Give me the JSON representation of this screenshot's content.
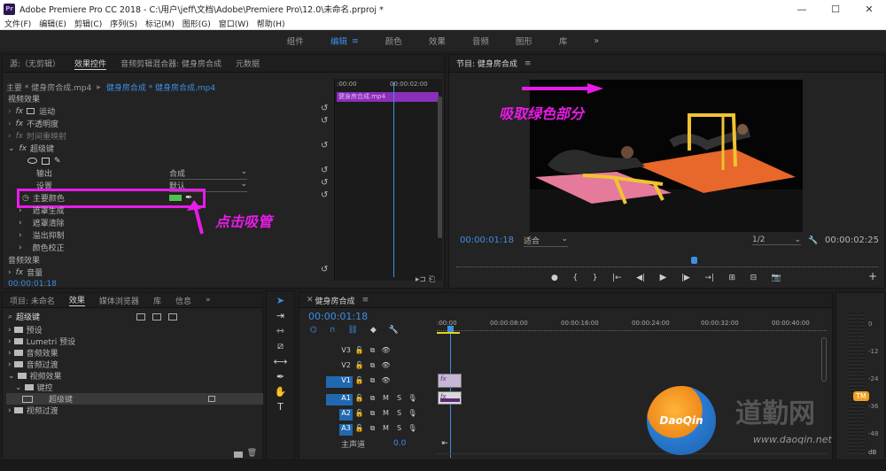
{
  "app": {
    "title": "Adobe Premiere Pro CC 2018 - C:\\用户\\jeff\\文档\\Adobe\\Premiere Pro\\12.0\\未命名.prproj *",
    "logo": "Pr"
  },
  "window": {
    "minimize": "—",
    "maximize": "☐",
    "close": "✕"
  },
  "menu": [
    "文件(F)",
    "编辑(E)",
    "剪辑(C)",
    "序列(S)",
    "标记(M)",
    "图形(G)",
    "窗口(W)",
    "帮助(H)"
  ],
  "workspaces": [
    "组件",
    "编辑",
    "颜色",
    "效果",
    "音频",
    "图形",
    "库"
  ],
  "workspace_more": "»",
  "source_panel": {
    "tabs": [
      "源:（无剪辑）",
      "效果控件",
      "音频剪辑混合器: 健身房合成",
      "元数据"
    ],
    "tab_menu": "≡",
    "clip_left": "主要 * 健身房合成.mp4",
    "clip_right": "健身房合成 * 健身房合成.mp4",
    "time_start": ":00:00",
    "time_end": "00:00:02:00",
    "clip_bar": "健身房合成.mp4",
    "video_effects": "视频效果",
    "effects": [
      "运动",
      "不透明度",
      "时间重映射",
      "超级键"
    ],
    "fx": "fx",
    "output_label": "输出",
    "output_value": "合成",
    "settings_label": "设置",
    "settings_value": "默认",
    "key_color_label": "主要颜色",
    "key_color": "#4fc24f",
    "sub_items": [
      "遮罩生成",
      "遮罩清除",
      "溢出抑制",
      "颜色校正"
    ],
    "audio_effects": "音频效果",
    "volume": "音量",
    "timecode": "00:00:01:18",
    "annotation_click": "点击吸管"
  },
  "program_panel": {
    "title": "节目: 健身房合成",
    "tab_menu": "≡",
    "annotation_pick": "吸取绿色部分",
    "timecode": "00:00:01:18",
    "fit": "适合",
    "quality": "1/2",
    "duration": "00:00:02:25",
    "controls": [
      "●",
      "{",
      "}",
      "|←",
      "◀|",
      "▶",
      "|▶",
      "→|",
      "⊞",
      "⊟",
      "📷"
    ],
    "add": "+"
  },
  "project_panel": {
    "tabs": [
      "项目: 未命名",
      "效果",
      "媒体浏览器",
      "库",
      "信息"
    ],
    "more": "»",
    "search_value": "超级键",
    "tree": [
      {
        "label": "预设",
        "level": 0,
        "type": "folder"
      },
      {
        "label": "Lumetri 预设",
        "level": 0,
        "type": "folder"
      },
      {
        "label": "音频效果",
        "level": 0,
        "type": "folder"
      },
      {
        "label": "音频过渡",
        "level": 0,
        "type": "folder"
      },
      {
        "label": "视频效果",
        "level": 0,
        "type": "folder",
        "open": true
      },
      {
        "label": "键控",
        "level": 1,
        "type": "folder",
        "open": true
      },
      {
        "label": "超级键",
        "level": 2,
        "type": "effect",
        "selected": true
      },
      {
        "label": "视频过渡",
        "level": 0,
        "type": "folder"
      }
    ]
  },
  "timeline": {
    "title": "健身房合成",
    "tab_menu": "≡",
    "timecode": "00:00:01:18",
    "ruler": [
      ":00:00",
      "00:00:08:00",
      "00:00:16:00",
      "00:00:24:00",
      "00:00:32:00",
      "00:00:40:00"
    ],
    "video_tracks": [
      "V3",
      "V2",
      "V1"
    ],
    "audio_tracks": [
      "A1",
      "A2",
      "A3"
    ],
    "master": "主声道",
    "master_value": "0.0",
    "clip_v_label": "fx",
    "clip_a_label": "fx"
  },
  "audio_meter": {
    "labels": [
      "0",
      "-12",
      "-24",
      "-36",
      "-48",
      "dB"
    ],
    "solo": "S"
  },
  "watermark": {
    "brand": "DaoQin",
    "site": "www.daoqin.net",
    "cn": "道勤网",
    "tm": "TM"
  }
}
